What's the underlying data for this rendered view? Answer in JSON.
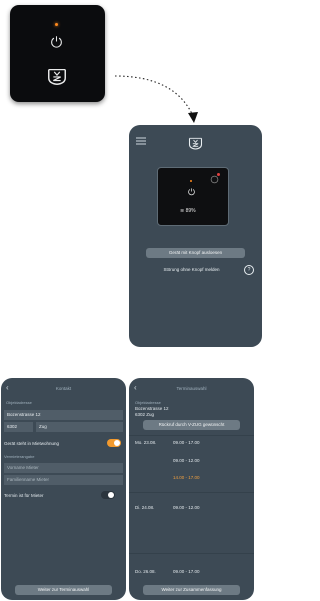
{
  "device": {
    "power_icon": "power-icon",
    "brand_icon": "vzug-logo"
  },
  "app": {
    "menu_icon": "menu-icon",
    "screen_percent": "89%",
    "btn_button_off": "Gerät mit Knopf ausloesen",
    "link_report": "Störung ohne Knopf melden",
    "help": "?"
  },
  "contact": {
    "title": "Kontakt",
    "section_address": "Objektadresse",
    "street": "Bozenstrasse 12",
    "zip": "6302",
    "city": "Zug",
    "rental_label": "Gerät steht in Mietwohnung",
    "section_owner": "Vermieterangabe",
    "owner_first_placeholder": "Vorname Mieter",
    "owner_last_placeholder": "Familienname Mieter",
    "appointment_label": "Termin ist für Mieter",
    "next_button": "Weiter zur Terminauswahl"
  },
  "schedule": {
    "title": "Terminauswahl",
    "section_address": "Objektadresse",
    "street": "Bozenstrasse 12",
    "city": "6302 Zug",
    "callback_button": "Rückruf durch V-ZUG gewünscht",
    "slots": [
      {
        "date": "Mo. 23.08.",
        "time": "09.00 - 17.00"
      },
      {
        "date": "",
        "time": "09.00 - 12.00"
      },
      {
        "date": "",
        "time": "14.00 - 17.00",
        "selected": true
      },
      {
        "date": "Di. 24.08.",
        "time": "09.00 - 12.00"
      },
      {
        "date": "Do. 26.08.",
        "time": "09.00 - 17.00"
      }
    ],
    "next_button": "Weiter zur Zusammenfassung"
  },
  "colors": {
    "accent": "#ff8a1e",
    "toggle_on": "#f29a2e",
    "screen_bg": "#3d4a55"
  }
}
